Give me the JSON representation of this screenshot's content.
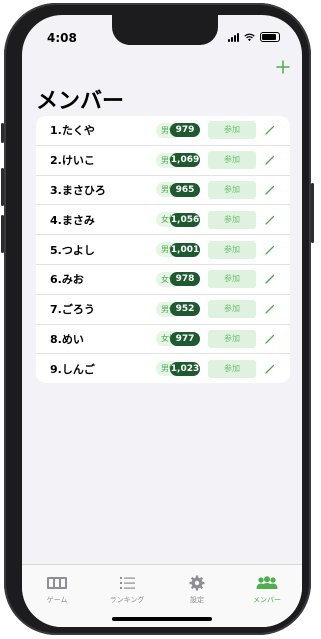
{
  "status_bar": {
    "time": "4:08"
  },
  "header": {
    "title": "メンバー",
    "add_icon": "plus-icon"
  },
  "members": [
    {
      "name": "1.たくや",
      "gender": "男性",
      "score": "979",
      "join_label": "参加"
    },
    {
      "name": "2.けいこ",
      "gender": "男性",
      "score": "1,069",
      "join_label": "参加"
    },
    {
      "name": "3.まさひろ",
      "gender": "男性",
      "score": "965",
      "join_label": "参加"
    },
    {
      "name": "4.まさみ",
      "gender": "女性",
      "score": "1,056",
      "join_label": "参加"
    },
    {
      "name": "5.つよし",
      "gender": "男性",
      "score": "1,001",
      "join_label": "参加"
    },
    {
      "name": "6.みお",
      "gender": "女性",
      "score": "978",
      "join_label": "参加"
    },
    {
      "name": "7.ごろう",
      "gender": "男性",
      "score": "952",
      "join_label": "参加"
    },
    {
      "name": "8.めい",
      "gender": "女性",
      "score": "977",
      "join_label": "参加"
    },
    {
      "name": "9.しんご",
      "gender": "男性",
      "score": "1,023",
      "join_label": "参加"
    }
  ],
  "tabs": [
    {
      "label": "ゲーム",
      "icon": "game-board-icon",
      "active": false
    },
    {
      "label": "ランキング",
      "icon": "list-icon",
      "active": false
    },
    {
      "label": "設定",
      "icon": "gear-icon",
      "active": false
    },
    {
      "label": "メンバー",
      "icon": "people-icon",
      "active": true
    }
  ],
  "colors": {
    "accent": "#4cae4f",
    "score_bg": "#1e5a2f",
    "join_bg": "#dff2df"
  }
}
